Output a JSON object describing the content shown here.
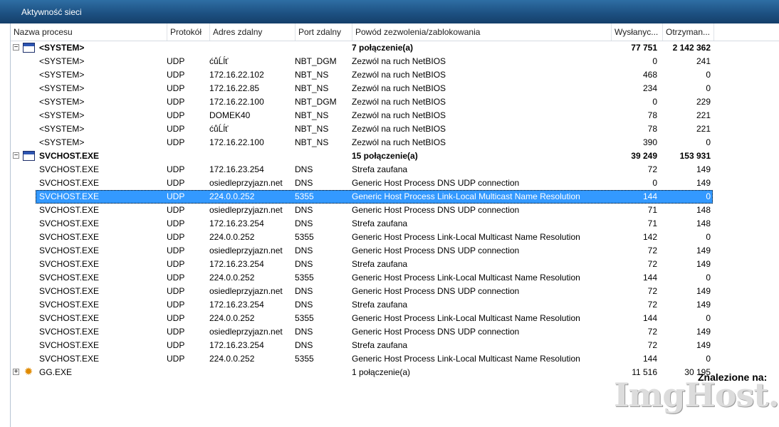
{
  "window": {
    "title": "Aktywność sieci"
  },
  "columns": {
    "process": "Nazwa procesu",
    "protocol": "Protokół",
    "address": "Adres zdalny",
    "port": "Port zdalny",
    "reason": "Powód zezwolenia/zablokowania",
    "sent": "Wysłanyc...",
    "received": "Otrzyman..."
  },
  "rows": [
    {
      "process": "<SYSTEM>",
      "protocol": "",
      "address": "",
      "port": "",
      "reason": "7 połączenie(a)",
      "sent": "77 751",
      "received": "2 142 362",
      "group": true,
      "expander": "−",
      "icon": "app-window-icon"
    },
    {
      "process": "<SYSTEM>",
      "protocol": "UDP",
      "address": "ćůĹĺť",
      "port": "NBT_DGM",
      "reason": "Zezwól na ruch NetBIOS",
      "sent": "0",
      "received": "241"
    },
    {
      "process": "<SYSTEM>",
      "protocol": "UDP",
      "address": "172.16.22.102",
      "port": "NBT_NS",
      "reason": "Zezwól na ruch NetBIOS",
      "sent": "468",
      "received": "0"
    },
    {
      "process": "<SYSTEM>",
      "protocol": "UDP",
      "address": "172.16.22.85",
      "port": "NBT_NS",
      "reason": "Zezwól na ruch NetBIOS",
      "sent": "234",
      "received": "0"
    },
    {
      "process": "<SYSTEM>",
      "protocol": "UDP",
      "address": "172.16.22.100",
      "port": "NBT_DGM",
      "reason": "Zezwól na ruch NetBIOS",
      "sent": "0",
      "received": "229"
    },
    {
      "process": "<SYSTEM>",
      "protocol": "UDP",
      "address": "DOMEK40",
      "port": "NBT_NS",
      "reason": "Zezwól na ruch NetBIOS",
      "sent": "78",
      "received": "221"
    },
    {
      "process": "<SYSTEM>",
      "protocol": "UDP",
      "address": "ćůĹĺť",
      "port": "NBT_NS",
      "reason": "Zezwól na ruch NetBIOS",
      "sent": "78",
      "received": "221"
    },
    {
      "process": "<SYSTEM>",
      "protocol": "UDP",
      "address": "172.16.22.100",
      "port": "NBT_NS",
      "reason": "Zezwól na ruch NetBIOS",
      "sent": "390",
      "received": "0"
    },
    {
      "process": "SVCHOST.EXE",
      "protocol": "",
      "address": "",
      "port": "",
      "reason": "15 połączenie(a)",
      "sent": "39 249",
      "received": "153 931",
      "group": true,
      "expander": "−",
      "icon": "app-window-icon"
    },
    {
      "process": "SVCHOST.EXE",
      "protocol": "UDP",
      "address": "172.16.23.254",
      "port": "DNS",
      "reason": "Strefa zaufana",
      "sent": "72",
      "received": "149"
    },
    {
      "process": "SVCHOST.EXE",
      "protocol": "UDP",
      "address": "osiedleprzyjazn.net",
      "port": "DNS",
      "reason": "Generic Host Process DNS UDP connection",
      "sent": "0",
      "received": "149"
    },
    {
      "process": "SVCHOST.EXE",
      "protocol": "UDP",
      "address": "224.0.0.252",
      "port": "5355",
      "reason": "Generic Host Process Link-Local Multicast Name Resolution",
      "sent": "144",
      "received": "0",
      "selected": true
    },
    {
      "process": "SVCHOST.EXE",
      "protocol": "UDP",
      "address": "osiedleprzyjazn.net",
      "port": "DNS",
      "reason": "Generic Host Process DNS UDP connection",
      "sent": "71",
      "received": "148"
    },
    {
      "process": "SVCHOST.EXE",
      "protocol": "UDP",
      "address": "172.16.23.254",
      "port": "DNS",
      "reason": "Strefa zaufana",
      "sent": "71",
      "received": "148"
    },
    {
      "process": "SVCHOST.EXE",
      "protocol": "UDP",
      "address": "224.0.0.252",
      "port": "5355",
      "reason": "Generic Host Process Link-Local Multicast Name Resolution",
      "sent": "142",
      "received": "0"
    },
    {
      "process": "SVCHOST.EXE",
      "protocol": "UDP",
      "address": "osiedleprzyjazn.net",
      "port": "DNS",
      "reason": "Generic Host Process DNS UDP connection",
      "sent": "72",
      "received": "149"
    },
    {
      "process": "SVCHOST.EXE",
      "protocol": "UDP",
      "address": "172.16.23.254",
      "port": "DNS",
      "reason": "Strefa zaufana",
      "sent": "72",
      "received": "149"
    },
    {
      "process": "SVCHOST.EXE",
      "protocol": "UDP",
      "address": "224.0.0.252",
      "port": "5355",
      "reason": "Generic Host Process Link-Local Multicast Name Resolution",
      "sent": "144",
      "received": "0"
    },
    {
      "process": "SVCHOST.EXE",
      "protocol": "UDP",
      "address": "osiedleprzyjazn.net",
      "port": "DNS",
      "reason": "Generic Host Process DNS UDP connection",
      "sent": "72",
      "received": "149"
    },
    {
      "process": "SVCHOST.EXE",
      "protocol": "UDP",
      "address": "172.16.23.254",
      "port": "DNS",
      "reason": "Strefa zaufana",
      "sent": "72",
      "received": "149"
    },
    {
      "process": "SVCHOST.EXE",
      "protocol": "UDP",
      "address": "224.0.0.252",
      "port": "5355",
      "reason": "Generic Host Process Link-Local Multicast Name Resolution",
      "sent": "144",
      "received": "0"
    },
    {
      "process": "SVCHOST.EXE",
      "protocol": "UDP",
      "address": "osiedleprzyjazn.net",
      "port": "DNS",
      "reason": "Generic Host Process DNS UDP connection",
      "sent": "72",
      "received": "149"
    },
    {
      "process": "SVCHOST.EXE",
      "protocol": "UDP",
      "address": "172.16.23.254",
      "port": "DNS",
      "reason": "Strefa zaufana",
      "sent": "72",
      "received": "149"
    },
    {
      "process": "SVCHOST.EXE",
      "protocol": "UDP",
      "address": "224.0.0.252",
      "port": "5355",
      "reason": "Generic Host Process Link-Local Multicast Name Resolution",
      "sent": "144",
      "received": "0"
    },
    {
      "process": "GG.EXE",
      "protocol": "",
      "address": "",
      "port": "",
      "reason": "1 połączenie(a)",
      "sent": "11 516",
      "received": "30 195",
      "group": true,
      "expander": "+",
      "icon": "gg-sun-icon",
      "plain": true
    }
  ],
  "overlay": {
    "found_label": "Znalezione na:",
    "watermark": "ImgHost.pl"
  }
}
